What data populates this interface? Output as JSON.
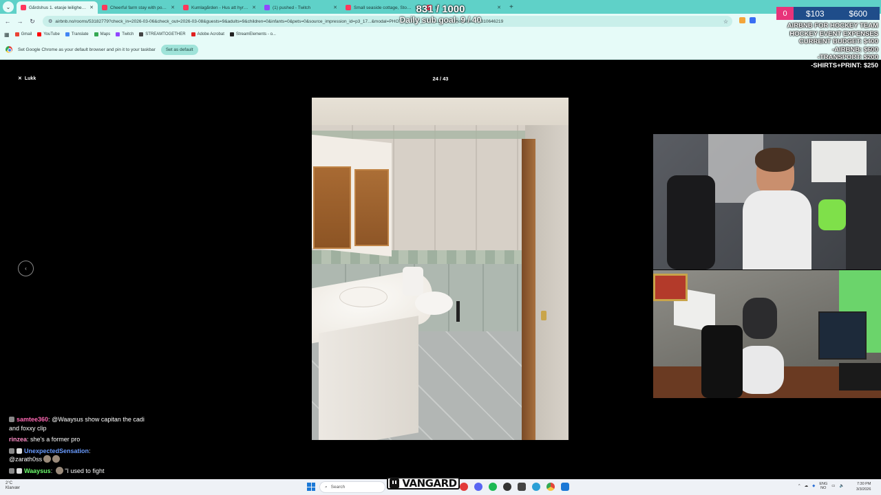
{
  "browser": {
    "tabs": [
      {
        "title": "Gårdshus 1. etasje leilighet. Ha",
        "color": "#ff385c",
        "active": true
      },
      {
        "title": "Cheerful farm stay with pool a",
        "color": "#ff385c",
        "active": false
      },
      {
        "title": "Kumlagården - Hus att hyra i &",
        "color": "#ff385c",
        "active": false
      },
      {
        "title": "(1) pushed - Twitch",
        "color": "#9146ff",
        "active": false
      },
      {
        "title": "Small seaside cottage, Stora E",
        "color": "#ff385c",
        "active": false
      },
      {
        "title": "N",
        "color": "#ff385c",
        "active": false
      }
    ],
    "url": "airbnb.no/rooms/53182779?check_in=2026-03-06&check_out=2026-03-08&guests=9&adults=9&children=0&infants=0&pets=0&source_impression_id=p3_17...&modal=PHOTO_TOUR_SCROLLABLE&modalItem=1310646219",
    "bookmarks": [
      {
        "label": "Gmail",
        "color": "#ea4335"
      },
      {
        "label": "YouTube",
        "color": "#ff0000"
      },
      {
        "label": "Translate",
        "color": "#4285f4"
      },
      {
        "label": "Maps",
        "color": "#34a853"
      },
      {
        "label": "Twitch",
        "color": "#9146ff"
      },
      {
        "label": "STREAMTOGETHER",
        "color": "#444444"
      },
      {
        "label": "Adobe Acrobat",
        "color": "#e02020"
      },
      {
        "label": "StreamElements - o...",
        "color": "#222222"
      }
    ],
    "infobar_text": "Set Google Chrome as your default browser and pin it to your taskbar",
    "infobar_button": "Set as default"
  },
  "viewer": {
    "close_label": "Lukk",
    "counter": "24 / 43"
  },
  "overlay": {
    "sub_count": "831 / 1000",
    "sub_goal": "Daily sub goal: 9 / 40",
    "money_pink": "0",
    "money_a": "$103",
    "money_b": "$600",
    "budget_lines": [
      "AIRBNB FOR HOCKEY TEAM",
      "HOCKEY EVENT EXPENSES",
      "CURRENT BUDGET: $400",
      "-AIRBNB: $600",
      "-TRANSPORT: $200",
      "-SHIRTS+PRINT: $250"
    ]
  },
  "chat": [
    {
      "user": "samtee360",
      "text": "@Waaysus show capitan the cadi and foxxy clip"
    },
    {
      "user": "rinzea",
      "text": "she's a former pro"
    },
    {
      "user": "UnexpectedSensation",
      "text": "@zarath0ss"
    },
    {
      "user": "Waaysus",
      "text": "\"I used to fight"
    }
  ],
  "taskbar": {
    "search_placeholder": "Search",
    "weather_temp": "2°C",
    "weather_desc": "Klarvær",
    "lang": "ENG",
    "lang_sub": "NO",
    "time": "7:30 PM",
    "date": "3/3/2026",
    "vangard_label": "VANGARD"
  }
}
